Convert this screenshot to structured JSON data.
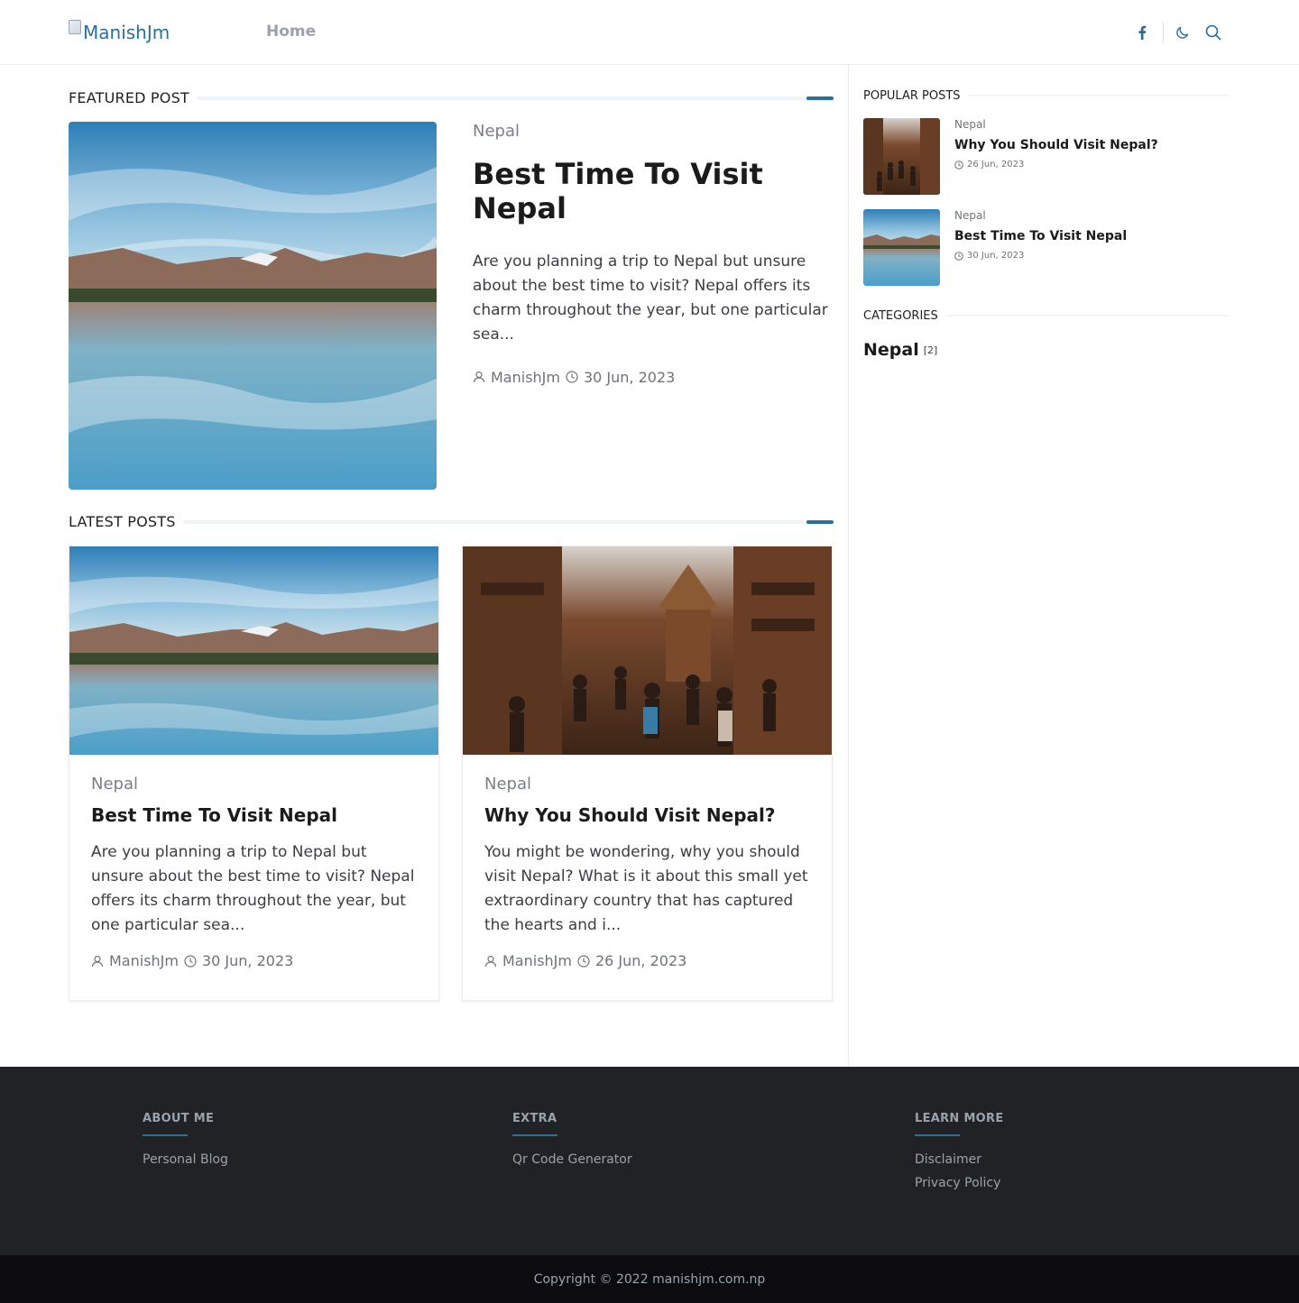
{
  "header": {
    "logo_alt": "ManishJm",
    "nav": {
      "home": "Home"
    },
    "icons": [
      "facebook-icon",
      "moon-icon",
      "search-icon"
    ]
  },
  "featured": {
    "section_title": "FEATURED POST",
    "category": "Nepal",
    "title": "Best Time To Visit Nepal",
    "excerpt": "Are you planning a trip to Nepal but unsure about the best time to visit? Nepal offers its charm throughout the year, but one particular sea...",
    "author": "ManishJm",
    "date": "30 Jun, 2023"
  },
  "latest": {
    "section_title": "LATEST POSTS",
    "posts": [
      {
        "category": "Nepal",
        "title": "Best Time To Visit Nepal",
        "excerpt": "Are you planning a trip to Nepal but unsure about the best time to visit? Nepal offers its charm throughout the year, but one particular sea...",
        "author": "ManishJm",
        "date": "30 Jun, 2023"
      },
      {
        "category": "Nepal",
        "title": "Why You Should Visit Nepal?",
        "excerpt": "You might be wondering, why you should visit Nepal? What is it about this small yet extraordinary country that has captured the hearts and i...",
        "author": "ManishJm",
        "date": "26 Jun, 2023"
      }
    ]
  },
  "sidebar": {
    "popular_title": "POPULAR POSTS",
    "popular": [
      {
        "category": "Nepal",
        "title": "Why You Should Visit Nepal?",
        "date": "26 Jun, 2023"
      },
      {
        "category": "Nepal",
        "title": "Best Time To Visit Nepal",
        "date": "30 Jun, 2023"
      }
    ],
    "categories_title": "CATEGORIES",
    "categories": [
      {
        "name": "Nepal",
        "count": "[2]"
      }
    ]
  },
  "footer": {
    "columns": [
      {
        "heading": "ABOUT ME",
        "links": [
          "Personal Blog"
        ]
      },
      {
        "heading": "EXTRA",
        "links": [
          "Qr Code Generator"
        ]
      },
      {
        "heading": "LEARN MORE",
        "links": [
          "Disclaimer",
          "Privacy Policy"
        ]
      }
    ],
    "copyright": "Copyright © 2022 manishjm.com.np"
  },
  "colors": {
    "accent": "#2a6f97",
    "footer_bg": "#202226",
    "copyright_bg": "#0c0c10",
    "muted_text": "#9aa3ab"
  }
}
